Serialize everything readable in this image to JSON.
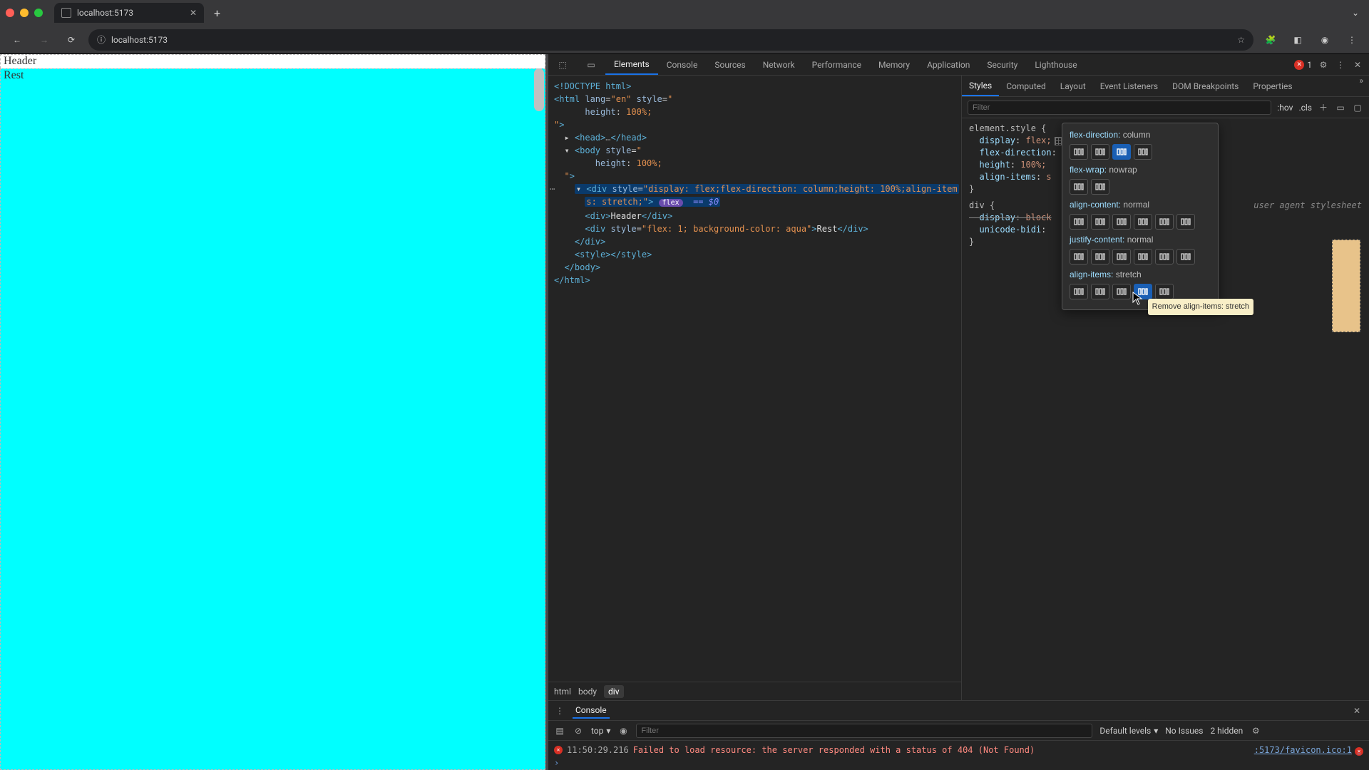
{
  "browser": {
    "tab_title": "localhost:5173",
    "url": "localhost:5173"
  },
  "page": {
    "header_text": "Header",
    "rest_text": "Rest"
  },
  "devtools": {
    "main_tabs": [
      "Elements",
      "Console",
      "Sources",
      "Network",
      "Performance",
      "Memory",
      "Application",
      "Security",
      "Lighthouse"
    ],
    "active_main_tab": "Elements",
    "error_count": "1",
    "dom_lines": [
      {
        "indent": 0,
        "html": "<span class='t-tag'>&lt;!DOCTYPE html&gt;</span>"
      },
      {
        "indent": 0,
        "html": "<span class='t-tag'>&lt;html</span> <span class='t-attr'>lang</span>=<span class='t-str'>\"en\"</span> <span class='t-attr'>style</span>=<span class='t-str'>\"</span>"
      },
      {
        "indent": 3,
        "html": "<span class='t-attr'>height</span>: <span class='t-str'>100%;</span>"
      },
      {
        "indent": 0,
        "html": "<span class='t-str'>\"</span><span class='t-tag'>&gt;</span>"
      },
      {
        "indent": 1,
        "html": "▸ <span class='t-tag'>&lt;head&gt;</span><span class='t-dim'>…</span><span class='t-tag'>&lt;/head&gt;</span>"
      },
      {
        "indent": 1,
        "html": "▾ <span class='t-tag'>&lt;body</span> <span class='t-attr'>style</span>=<span class='t-str'>\"</span>"
      },
      {
        "indent": 4,
        "html": "<span class='t-attr'>height</span>: <span class='t-str'>100%;</span>"
      },
      {
        "indent": 1,
        "html": "<span class='t-str'>\"</span><span class='t-tag'>&gt;</span>"
      },
      {
        "indent": 2,
        "sel": true,
        "html": "▾ <span class='t-tag'>&lt;div</span> <span class='t-attr'>style</span>=<span class='t-str'>\"display: flex;flex-direction: column;height: 100%;align-item</span>"
      },
      {
        "indent": 3,
        "sel": true,
        "html": "<span class='t-str'>s: stretch;\"</span><span class='t-tag'>&gt;</span> <span class='flex-pill'>flex</span>  <span class='eq0'>== $0</span>"
      },
      {
        "indent": 3,
        "html": "<span class='t-tag'>&lt;div&gt;</span><span class='t-txt'>Header</span><span class='t-tag'>&lt;/div&gt;</span>"
      },
      {
        "indent": 3,
        "html": "<span class='t-tag'>&lt;div</span> <span class='t-attr'>style</span>=<span class='t-str'>\"flex: 1; background-color: aqua\"</span><span class='t-tag'>&gt;</span><span class='t-txt'>Rest</span><span class='t-tag'>&lt;/div&gt;</span>"
      },
      {
        "indent": 2,
        "html": "<span class='t-tag'>&lt;/div&gt;</span>"
      },
      {
        "indent": 2,
        "html": "<span class='t-tag'>&lt;style&gt;&lt;/style&gt;</span>"
      },
      {
        "indent": 1,
        "html": "<span class='t-tag'>&lt;/body&gt;</span>"
      },
      {
        "indent": 0,
        "html": "<span class='t-tag'>&lt;/html&gt;</span>"
      }
    ],
    "crumbs": [
      "html",
      "body",
      "div"
    ],
    "styles": {
      "tabs": [
        "Styles",
        "Computed",
        "Layout",
        "Event Listeners",
        "DOM Breakpoints",
        "Properties"
      ],
      "active_tab": "Styles",
      "filter_placeholder": "Filter",
      "hov": ":hov",
      "cls": ".cls",
      "element_style_label": "element.style {",
      "props": [
        {
          "k": "display",
          "v": "flex;",
          "swatch": true
        },
        {
          "k": "flex-direction",
          "v": "column;",
          "partial": true
        },
        {
          "k": "height",
          "v": "100%;"
        },
        {
          "k": "align-items",
          "v": "s",
          "partial": true
        }
      ],
      "ua_label": "user agent stylesheet",
      "ua_selector": "div {",
      "ua_props": [
        {
          "k": "display",
          "v": "block",
          "strike": true
        },
        {
          "k": "unicode-bidi",
          "v": "",
          "partial": true
        }
      ]
    },
    "flex_popover": {
      "rows": [
        {
          "label": "flex-direction:",
          "value": "column",
          "active": 2,
          "count": 4
        },
        {
          "label": "flex-wrap:",
          "value": "nowrap",
          "active": -1,
          "count": 2
        },
        {
          "label": "align-content:",
          "value": "normal",
          "active": -1,
          "count": 6
        },
        {
          "label": "justify-content:",
          "value": "normal",
          "active": -1,
          "count": 6
        },
        {
          "label": "align-items:",
          "value": "stretch",
          "active": 3,
          "count": 5
        }
      ],
      "tooltip": "Remove align-items: stretch"
    },
    "console": {
      "tab": "Console",
      "context": "top",
      "filter_placeholder": "Filter",
      "levels": "Default levels",
      "issues": "No Issues",
      "hidden": "2 hidden",
      "log_ts": "11:50:29.216",
      "log_msg": "Failed to load resource: the server responded with a status of 404 (Not Found)",
      "log_link": ":5173/favicon.ico:1"
    }
  }
}
